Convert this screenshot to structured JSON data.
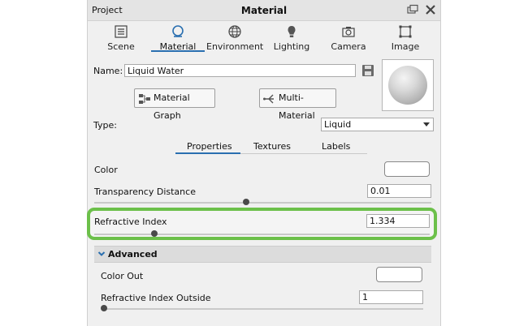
{
  "panel": {
    "left_title": "Project",
    "title": "Material"
  },
  "tabs": [
    {
      "label": "Scene",
      "icon": "list-icon"
    },
    {
      "label": "Material",
      "icon": "material-sphere-icon"
    },
    {
      "label": "Environment",
      "icon": "globe-icon"
    },
    {
      "label": "Lighting",
      "icon": "bulb-icon"
    },
    {
      "label": "Camera",
      "icon": "camera-icon"
    },
    {
      "label": "Image",
      "icon": "frame-icon"
    }
  ],
  "active_tab": "Material",
  "name_field": {
    "label": "Name:",
    "value": "Liquid Water"
  },
  "buttons": {
    "material_graph": "Material Graph",
    "multi_material": "Multi-Material"
  },
  "type_field": {
    "label": "Type:",
    "value": "Liquid"
  },
  "subtabs": [
    "Properties",
    "Textures",
    "Labels"
  ],
  "active_subtab": "Properties",
  "properties": {
    "color_label": "Color",
    "transparency_label": "Transparency Distance",
    "transparency_value": "0.01",
    "transparency_slider": 0.45,
    "refractive_label": "Refractive Index",
    "refractive_value": "1.334",
    "refractive_slider": 0.18
  },
  "advanced": {
    "header": "Advanced",
    "color_out_label": "Color Out",
    "refr_outside_label": "Refractive Index Outside",
    "refr_outside_value": "1",
    "refr_outside_slider": 0.0
  },
  "colors": {
    "highlight": "#6cc04a",
    "accent": "#2a6fb0",
    "panel_bg": "#f0f0f0"
  }
}
